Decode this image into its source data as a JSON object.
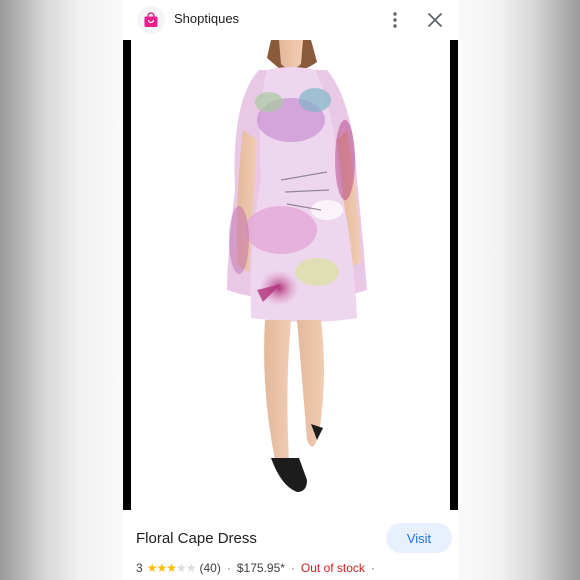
{
  "header": {
    "app_name": "Shoptiques",
    "app_icon": "shopping-bag-icon",
    "more_icon": "more-vert-icon",
    "close_icon": "close-icon"
  },
  "product": {
    "title": "Floral Cape Dress",
    "visit_label": "Visit",
    "rating": "3",
    "rating_value": 3,
    "rating_max": 5,
    "review_count": "(40)",
    "price": "$175.95*",
    "stock_status": "Out of stock",
    "separator": "·"
  },
  "colors": {
    "accent": "#1a73e8",
    "visit_bg": "#e8f0fe",
    "brand": "#e91e8c",
    "star_filled": "#fbbc04",
    "out_of_stock": "#c5221f"
  }
}
